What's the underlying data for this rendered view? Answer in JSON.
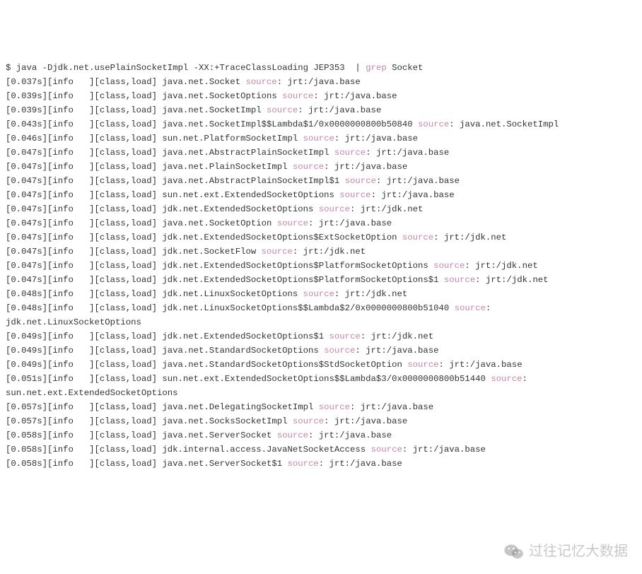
{
  "lines": [
    [
      {
        "t": "$ java -Djdk.net.usePlainSocketImpl -XX:+TraceClassLoading JEP353  | "
      },
      {
        "t": "grep",
        "class": "kw"
      },
      {
        "t": " Socket"
      }
    ],
    [
      {
        "t": "[0.037s][info   ][class,load] java.net.Socket "
      },
      {
        "t": "source",
        "class": "kw"
      },
      {
        "t": ": jrt:/java.base"
      }
    ],
    [
      {
        "t": "[0.039s][info   ][class,load] java.net.SocketOptions "
      },
      {
        "t": "source",
        "class": "kw"
      },
      {
        "t": ": jrt:/java.base"
      }
    ],
    [
      {
        "t": "[0.039s][info   ][class,load] java.net.SocketImpl "
      },
      {
        "t": "source",
        "class": "kw"
      },
      {
        "t": ": jrt:/java.base"
      }
    ],
    [
      {
        "t": "[0.043s][info   ][class,load] java.net.SocketImpl$$Lambda$1/0x0000000800b50840 "
      },
      {
        "t": "source",
        "class": "kw"
      },
      {
        "t": ": java.net.SocketImpl"
      }
    ],
    [
      {
        "t": "[0.046s][info   ][class,load] sun.net.PlatformSocketImpl "
      },
      {
        "t": "source",
        "class": "kw"
      },
      {
        "t": ": jrt:/java.base"
      }
    ],
    [
      {
        "t": "[0.047s][info   ][class,load] java.net.AbstractPlainSocketImpl "
      },
      {
        "t": "source",
        "class": "kw"
      },
      {
        "t": ": jrt:/java.base"
      }
    ],
    [
      {
        "t": "[0.047s][info   ][class,load] java.net.PlainSocketImpl "
      },
      {
        "t": "source",
        "class": "kw"
      },
      {
        "t": ": jrt:/java.base"
      }
    ],
    [
      {
        "t": "[0.047s][info   ][class,load] java.net.AbstractPlainSocketImpl$1 "
      },
      {
        "t": "source",
        "class": "kw"
      },
      {
        "t": ": jrt:/java.base"
      }
    ],
    [
      {
        "t": "[0.047s][info   ][class,load] sun.net.ext.ExtendedSocketOptions "
      },
      {
        "t": "source",
        "class": "kw"
      },
      {
        "t": ": jrt:/java.base"
      }
    ],
    [
      {
        "t": "[0.047s][info   ][class,load] jdk.net.ExtendedSocketOptions "
      },
      {
        "t": "source",
        "class": "kw"
      },
      {
        "t": ": jrt:/jdk.net"
      }
    ],
    [
      {
        "t": "[0.047s][info   ][class,load] java.net.SocketOption "
      },
      {
        "t": "source",
        "class": "kw"
      },
      {
        "t": ": jrt:/java.base"
      }
    ],
    [
      {
        "t": "[0.047s][info   ][class,load] jdk.net.ExtendedSocketOptions$ExtSocketOption "
      },
      {
        "t": "source",
        "class": "kw"
      },
      {
        "t": ": jrt:/jdk.net"
      }
    ],
    [
      {
        "t": "[0.047s][info   ][class,load] jdk.net.SocketFlow "
      },
      {
        "t": "source",
        "class": "kw"
      },
      {
        "t": ": jrt:/jdk.net"
      }
    ],
    [
      {
        "t": "[0.047s][info   ][class,load] jdk.net.ExtendedSocketOptions$PlatformSocketOptions "
      },
      {
        "t": "source",
        "class": "kw"
      },
      {
        "t": ": jrt:/jdk.net"
      }
    ],
    [
      {
        "t": "[0.047s][info   ][class,load] jdk.net.ExtendedSocketOptions$PlatformSocketOptions$1 "
      },
      {
        "t": "source",
        "class": "kw"
      },
      {
        "t": ": jrt:/jdk.net"
      }
    ],
    [
      {
        "t": "[0.048s][info   ][class,load] jdk.net.LinuxSocketOptions "
      },
      {
        "t": "source",
        "class": "kw"
      },
      {
        "t": ": jrt:/jdk.net"
      }
    ],
    [
      {
        "t": "[0.048s][info   ][class,load] jdk.net.LinuxSocketOptions$$Lambda$2/0x0000000800b51040 "
      },
      {
        "t": "source",
        "class": "kw"
      },
      {
        "t": ": "
      }
    ],
    [
      {
        "t": "jdk.net.LinuxSocketOptions"
      }
    ],
    [
      {
        "t": "[0.049s][info   ][class,load] jdk.net.ExtendedSocketOptions$1 "
      },
      {
        "t": "source",
        "class": "kw"
      },
      {
        "t": ": jrt:/jdk.net"
      }
    ],
    [
      {
        "t": "[0.049s][info   ][class,load] java.net.StandardSocketOptions "
      },
      {
        "t": "source",
        "class": "kw"
      },
      {
        "t": ": jrt:/java.base"
      }
    ],
    [
      {
        "t": "[0.049s][info   ][class,load] java.net.StandardSocketOptions$StdSocketOption "
      },
      {
        "t": "source",
        "class": "kw"
      },
      {
        "t": ": jrt:/java.base"
      }
    ],
    [
      {
        "t": "[0.051s][info   ][class,load] sun.net.ext.ExtendedSocketOptions$$Lambda$3/0x0000000800b51440 "
      },
      {
        "t": "source",
        "class": "kw"
      },
      {
        "t": ": "
      }
    ],
    [
      {
        "t": "sun.net.ext.ExtendedSocketOptions"
      }
    ],
    [
      {
        "t": "[0.057s][info   ][class,load] java.net.DelegatingSocketImpl "
      },
      {
        "t": "source",
        "class": "kw"
      },
      {
        "t": ": jrt:/java.base"
      }
    ],
    [
      {
        "t": "[0.057s][info   ][class,load] java.net.SocksSocketImpl "
      },
      {
        "t": "source",
        "class": "kw"
      },
      {
        "t": ": jrt:/java.base"
      }
    ],
    [
      {
        "t": "[0.058s][info   ][class,load] java.net.ServerSocket "
      },
      {
        "t": "source",
        "class": "kw"
      },
      {
        "t": ": jrt:/java.base"
      }
    ],
    [
      {
        "t": "[0.058s][info   ][class,load] jdk.internal.access.JavaNetSocketAccess "
      },
      {
        "t": "source",
        "class": "kw"
      },
      {
        "t": ": jrt:/java.base"
      }
    ],
    [
      {
        "t": "[0.058s][info   ][class,load] java.net.ServerSocket$1 "
      },
      {
        "t": "source",
        "class": "kw"
      },
      {
        "t": ": jrt:/java.base"
      }
    ]
  ],
  "watermark": {
    "text": "过往记忆大数据"
  }
}
